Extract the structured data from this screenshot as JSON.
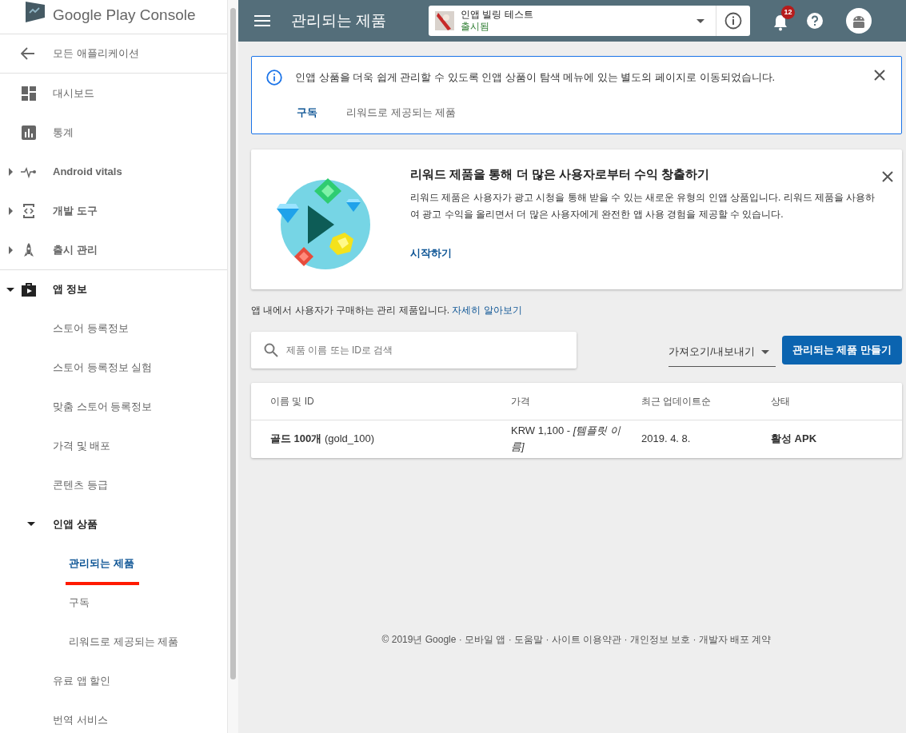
{
  "logo": {
    "text": "Google Play Console"
  },
  "sidebar": {
    "back": "모든 애플리케이션",
    "items": [
      {
        "label": "대시보드"
      },
      {
        "label": "통계"
      },
      {
        "label": "Android vitals",
        "expanded": false,
        "expandable": true
      },
      {
        "label": "개발 도구",
        "expanded": false,
        "expandable": true
      },
      {
        "label": "출시 관리",
        "expanded": false,
        "expandable": true
      },
      {
        "label": "앱 정보",
        "expanded": true,
        "expandable": true,
        "children": [
          {
            "label": "스토어 등록정보"
          },
          {
            "label": "스토어 등록정보 실험"
          },
          {
            "label": "맞춤 스토어 등록정보"
          },
          {
            "label": "가격 및 배포"
          },
          {
            "label": "콘텐츠 등급"
          },
          {
            "label": "인앱 상품",
            "expanded": true,
            "expandable": true,
            "children": [
              {
                "label": "관리되는 제품",
                "selected": true
              },
              {
                "label": "구독",
                "selected": false
              },
              {
                "label": "리워드로 제공되는 제품",
                "selected": false
              }
            ]
          },
          {
            "label": "유료 앱 할인"
          },
          {
            "label": "번역 서비스"
          }
        ]
      }
    ]
  },
  "topbar": {
    "title": "관리되는 제품",
    "app_name": "인앱 빌링 테스트",
    "app_status": "출시됨",
    "notification_count": "12"
  },
  "notice": {
    "text": "인앱 상품을 더욱 쉽게 관리할 수 있도록 인앱 상품이 탐색 메뉴에 있는 별도의 페이지로 이동되었습니다.",
    "links": [
      {
        "label": "구독",
        "selected": true
      },
      {
        "label": "리워드로 제공되는 제품",
        "selected": false
      }
    ]
  },
  "promo": {
    "title": "리워드 제품을 통해 더 많은 사용자로부터 수익 창출하기",
    "body": "리워드 제품은 사용자가 광고 시청을 통해 받을 수 있는 새로운 유형의 인앱 상품입니다. 리워드 제품을 사용하여 광고 수익을 올리면서 더 많은 사용자에게 완전한 앱 사용 경험을 제공할 수 있습니다.",
    "action": "시작하기"
  },
  "intro": {
    "text": "앱 내에서 사용자가 구매하는 관리 제품입니다. ",
    "link": "자세히 알아보기"
  },
  "toolbar": {
    "search_placeholder": "제품 이름 또는 ID로 검색",
    "import_export": "가져오기/내보내기",
    "create_button": "관리되는 제품 만들기"
  },
  "table": {
    "columns": [
      "이름 및 ID",
      "가격",
      "최근 업데이트순",
      "상태"
    ],
    "rows": [
      {
        "cells": [
          "**골드 100개** (gold_100)",
          "KRW 1,100 - *[템플릿 이름]*",
          "2019. 4. 8.",
          "활성 APK"
        ]
      }
    ]
  },
  "footer": {
    "text": "© 2019년 Google · 모바일 앱 · 도움말 · 사이트 이용약관 · 개인정보 보호 · 개발자 배포 계약"
  }
}
